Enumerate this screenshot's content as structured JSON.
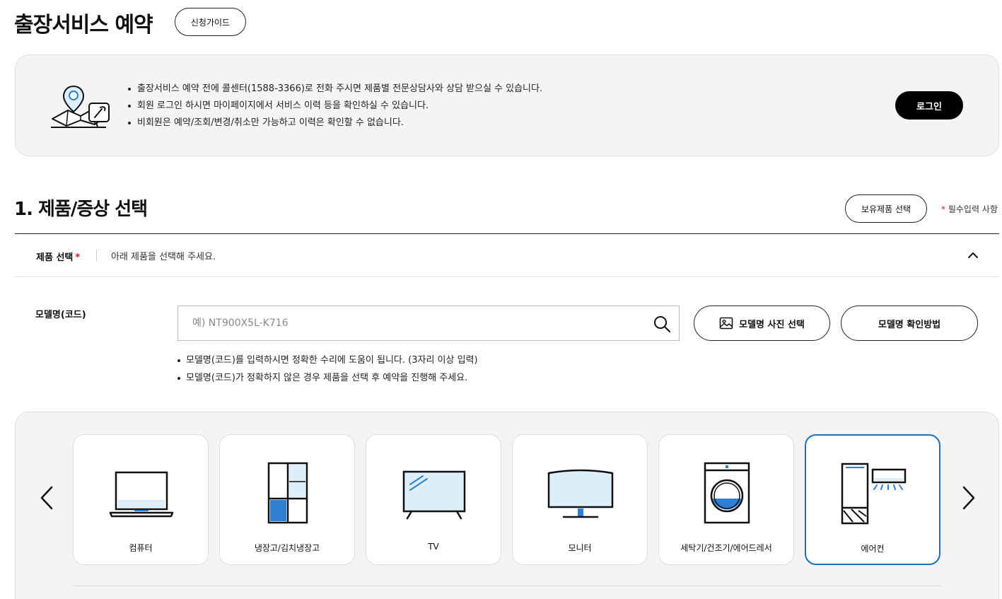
{
  "header": {
    "title": "출장서비스 예약",
    "guide_button": "신청가이드"
  },
  "notice": {
    "illustration_icon": "map-repair-icon",
    "items": [
      "출장서비스 예약 전에 콜센터(1588-3366)로 전화 주시면 제품별 전문상담사와 상담 받으실 수 있습니다.",
      "회원 로그인 하시면 마이페이지에서 서비스 이력 등을 확인하실 수 있습니다.",
      "비회원은 예약/조회/변경/취소만 가능하고 이력은 확인할 수 없습니다."
    ],
    "login_button": "로그인"
  },
  "section1": {
    "title": "1. 제품/증상 선택",
    "owned_button": "보유제품 선택",
    "required_star": "*",
    "required_note": "필수입력 사항",
    "product_select": {
      "label": "제품 선택",
      "star": "*",
      "hint": "아래 제품을 선택해 주세요."
    },
    "model": {
      "label": "모델명(코드)",
      "value": "",
      "placeholder": "예) NT900X5L-K716",
      "photo_button": "모델명 사진 선택",
      "howto_button": "모델명 확인방법",
      "notes": [
        "모델명(코드)를 입력하시면 정확한 수리에 도움이 됩니다. (3자리 이상 입력)",
        "모델명(코드)가 정확하지 않은 경우 제품을 선택 후 예약을 진행해 주세요."
      ]
    },
    "categories": [
      {
        "label": "컴퓨터",
        "icon": "laptop-icon",
        "selected": false
      },
      {
        "label": "냉장고/김치냉장고",
        "icon": "refrigerator-icon",
        "selected": false
      },
      {
        "label": "TV",
        "icon": "tv-icon",
        "selected": false
      },
      {
        "label": "모니터",
        "icon": "monitor-icon",
        "selected": false
      },
      {
        "label": "세탁기/건조기/에어드레서",
        "icon": "washer-icon",
        "selected": false
      },
      {
        "label": "에어컨",
        "icon": "air-conditioner-icon",
        "selected": true
      }
    ]
  },
  "colors": {
    "accent_blue": "#1b6fbd",
    "icon_fill_light": "#dbeefa",
    "icon_fill_strong": "#2d7fd3",
    "required_red": "#d12222",
    "panel_bg": "#f4f4f4"
  }
}
